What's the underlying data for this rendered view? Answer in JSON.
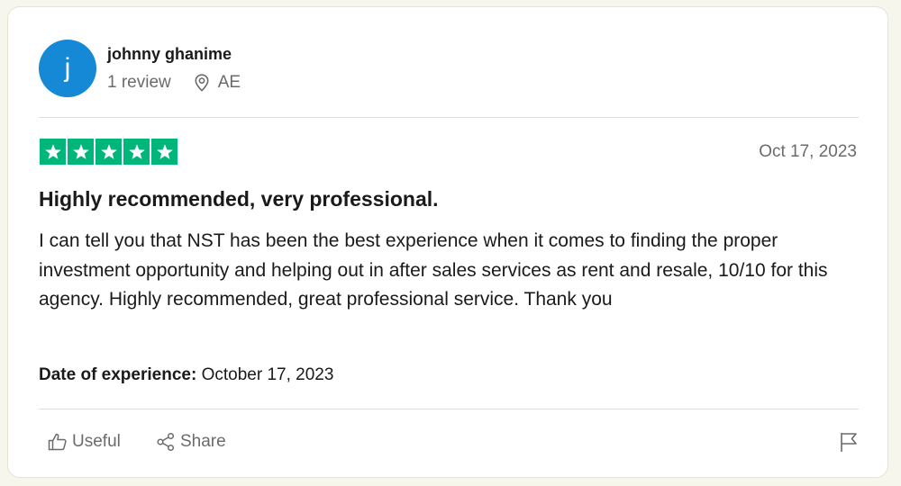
{
  "reviewer": {
    "avatar_initial": "j",
    "name": "johnny ghanime",
    "review_count": "1 review",
    "country": "AE",
    "avatar_color": "#1589d6"
  },
  "review": {
    "rating": 5,
    "rating_max": 5,
    "date": "Oct 17, 2023",
    "title": "Highly recommended, very professional.",
    "body": "I can tell you that NST has been the best experience when it comes to finding the proper investment opportunity and helping out in after sales services as rent and resale, 10/10 for this agency. Highly recommended, great professional service. Thank you",
    "experience_label": "Date of experience:",
    "experience_date": "October 17, 2023",
    "star_color": "#00b67a"
  },
  "actions": {
    "useful_label": "Useful",
    "share_label": "Share",
    "useful_icon": "thumbs-up-icon",
    "share_icon": "share-icon",
    "report_icon": "flag-icon"
  }
}
